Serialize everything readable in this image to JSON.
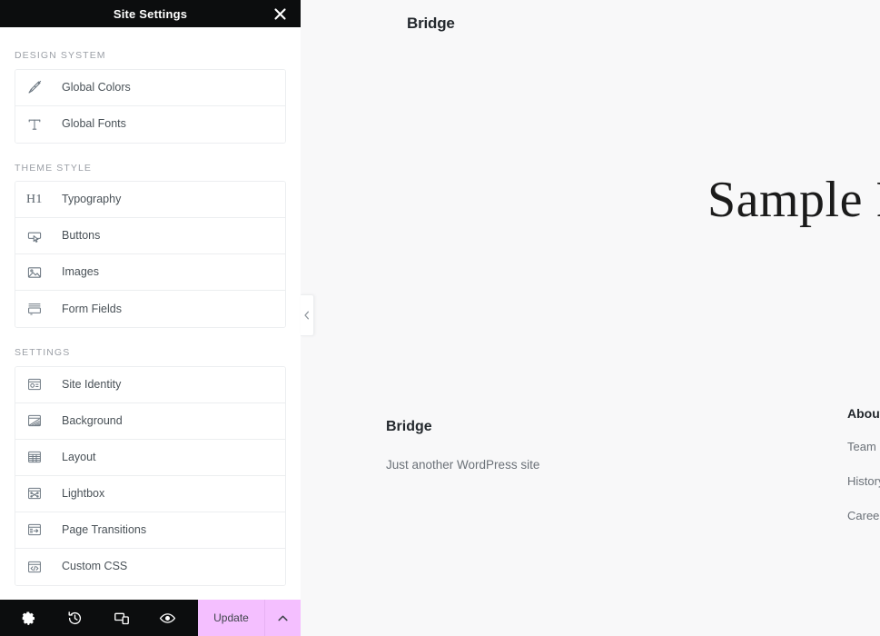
{
  "panel": {
    "title": "Site Settings",
    "close_icon": "close-icon",
    "sections": [
      {
        "label": "DESIGN SYSTEM",
        "items": [
          {
            "label": "Global Colors",
            "icon": "paintbrush-icon"
          },
          {
            "label": "Global Fonts",
            "icon": "typography-t-icon"
          }
        ]
      },
      {
        "label": "THEME STYLE",
        "items": [
          {
            "label": "Typography",
            "icon": "heading-h1-icon",
            "glyph": "H1"
          },
          {
            "label": "Buttons",
            "icon": "button-cursor-icon"
          },
          {
            "label": "Images",
            "icon": "image-icon"
          },
          {
            "label": "Form Fields",
            "icon": "form-fields-icon"
          }
        ]
      },
      {
        "label": "SETTINGS",
        "items": [
          {
            "label": "Site Identity",
            "icon": "site-identity-icon"
          },
          {
            "label": "Background",
            "icon": "background-icon"
          },
          {
            "label": "Layout",
            "icon": "layout-icon"
          },
          {
            "label": "Lightbox",
            "icon": "lightbox-icon"
          },
          {
            "label": "Page Transitions",
            "icon": "page-transitions-icon"
          },
          {
            "label": "Custom CSS",
            "icon": "custom-css-code-icon"
          }
        ]
      }
    ]
  },
  "footer_toolbar": {
    "tools": [
      {
        "name": "settings-gear-icon"
      },
      {
        "name": "history-icon"
      },
      {
        "name": "responsive-mode-icon"
      },
      {
        "name": "preview-eye-icon"
      }
    ],
    "update_label": "Update",
    "update_caret_icon": "chevron-up-icon",
    "update_color": "#f4bfff"
  },
  "collapse_handle": {
    "icon": "chevron-left-icon"
  },
  "preview": {
    "background_color": "#f8f8f9",
    "site_logo": "Bridge",
    "hero_title": "Sample P",
    "footer": {
      "brand": "Bridge",
      "tagline": "Just another WordPress site",
      "column_title": "About",
      "links": [
        "Team",
        "History",
        "Careers"
      ]
    }
  }
}
